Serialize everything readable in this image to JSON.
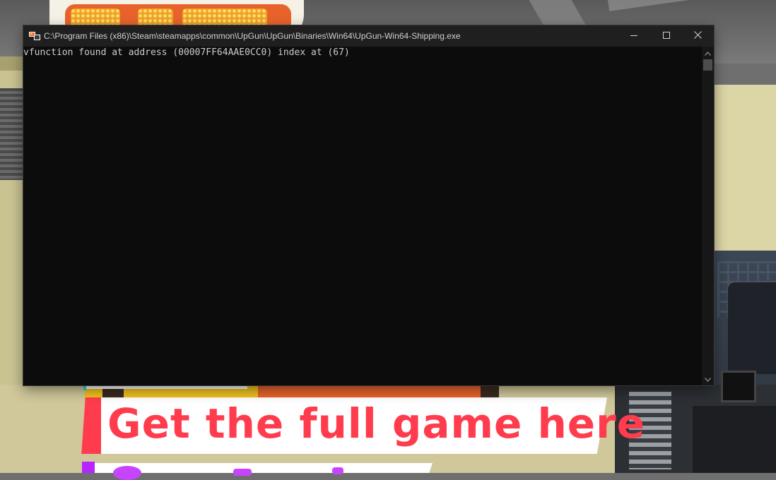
{
  "window": {
    "title": "C:\\Program Files (x86)\\Steam\\steamapps\\common\\UpGun\\UpGun\\Binaries\\Win64\\UpGun-Win64-Shipping.exe",
    "icon": "console-app-icon",
    "controls": [
      "minimize-icon",
      "maximize-icon",
      "close-icon"
    ]
  },
  "console": {
    "lines": [
      "vfunction found at address (00007FF64AAE0CC0) index at (67)"
    ],
    "background": "#0c0c0c",
    "text_color": "#cccccc"
  },
  "background": {
    "promo_text": "Get the full game here",
    "promo_color": "#ff3c4d"
  }
}
